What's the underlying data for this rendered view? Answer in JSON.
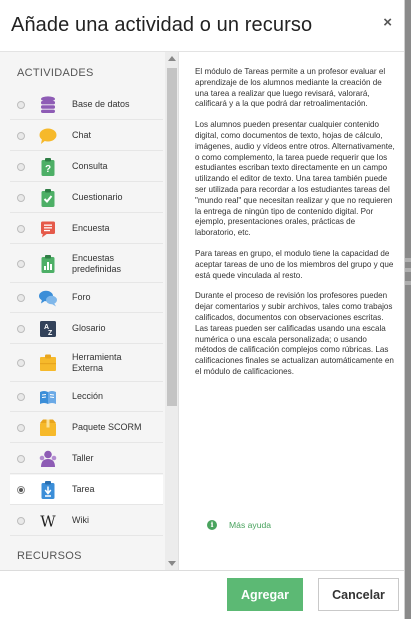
{
  "dialog": {
    "title": "Añade una actividad o un recurso",
    "close_symbol": "×"
  },
  "sections": {
    "activities": "ACTIVIDADES",
    "resources": "RECURSOS"
  },
  "activities": [
    {
      "label": "Base de datos",
      "icon": "database-icon",
      "color": "#8e5cb5",
      "selected": false
    },
    {
      "label": "Chat",
      "icon": "chat-bubble-icon",
      "color": "#f6b92b",
      "selected": false
    },
    {
      "label": "Consulta",
      "icon": "choice-clipboard-icon",
      "color": "#4daf66",
      "selected": false
    },
    {
      "label": "Cuestionario",
      "icon": "quiz-check-icon",
      "color": "#4daf66",
      "selected": false
    },
    {
      "label": "Encuesta",
      "icon": "feedback-list-icon",
      "color": "#e55a4a",
      "selected": false
    },
    {
      "label": "Encuestas\npredefinidas",
      "icon": "survey-chart-icon",
      "color": "#4daf66",
      "selected": false
    },
    {
      "label": "Foro",
      "icon": "forum-bubbles-icon",
      "color": "#3b8ed8",
      "selected": false
    },
    {
      "label": "Glosario",
      "icon": "glossary-az-icon",
      "color": "#33425a",
      "selected": false
    },
    {
      "label": "Herramienta\nExterna",
      "icon": "external-tool-puzzle-icon",
      "color": "#f6b92b",
      "selected": false
    },
    {
      "label": "Lección",
      "icon": "lesson-book-icon",
      "color": "#3b8ed8",
      "selected": false
    },
    {
      "label": "Paquete SCORM",
      "icon": "scorm-package-icon",
      "color": "#f6b92b",
      "selected": false
    },
    {
      "label": "Taller",
      "icon": "workshop-people-icon",
      "color": "#8e5cb5",
      "selected": false
    },
    {
      "label": "Tarea",
      "icon": "assignment-hand-icon",
      "color": "#3b8ed8",
      "selected": true
    },
    {
      "label": "Wiki",
      "icon": "wiki-w-icon",
      "color": "#222222",
      "selected": false
    }
  ],
  "description": [
    "El módulo de Tareas permite a un profesor evaluar el aprendizaje de los alumnos mediante la creación de una tarea a realizar que luego revisará, valorará, calificará y a la que podrá dar retroalimentación.",
    "Los alumnos pueden presentar cualquier contenido digital, como documentos de texto, hojas de cálculo, imágenes, audio y vídeos entre otros. Alternativamente, o como complemento, la tarea puede requerir que los estudiantes escriban texto directamente en un campo utilizando el editor de texto. Una tarea también puede ser utilizada para recordar a los estudiantes tareas del \"mundo real\" que necesitan realizar y que no requieren la entrega de ningún tipo de contenido digital. Por ejemplo, presentaciones orales, prácticas de laboratorio, etc.",
    "Para tareas en grupo, el modulo tiene la capacidad de aceptar tareas de uno de los miembros del grupo y que está quede vinculada al resto.",
    "Durante el proceso de revisión los profesores pueden dejar comentarios y subir archivos, tales como trabajos calificados, documentos con observaciones escritas. Las tareas pueden ser calificadas usando una escala numérica o una escala personalizada; o usando métodos de calificación complejos como rúbricas. Las calificaciones finales se actualizan automáticamente en el módulo de calificaciones."
  ],
  "help": {
    "icon_glyph": "i",
    "label": "Más ayuda"
  },
  "footer": {
    "add_label": "Agregar",
    "cancel_label": "Cancelar"
  },
  "colors": {
    "accent_green": "#5cb974",
    "help_green": "#49a35e"
  }
}
